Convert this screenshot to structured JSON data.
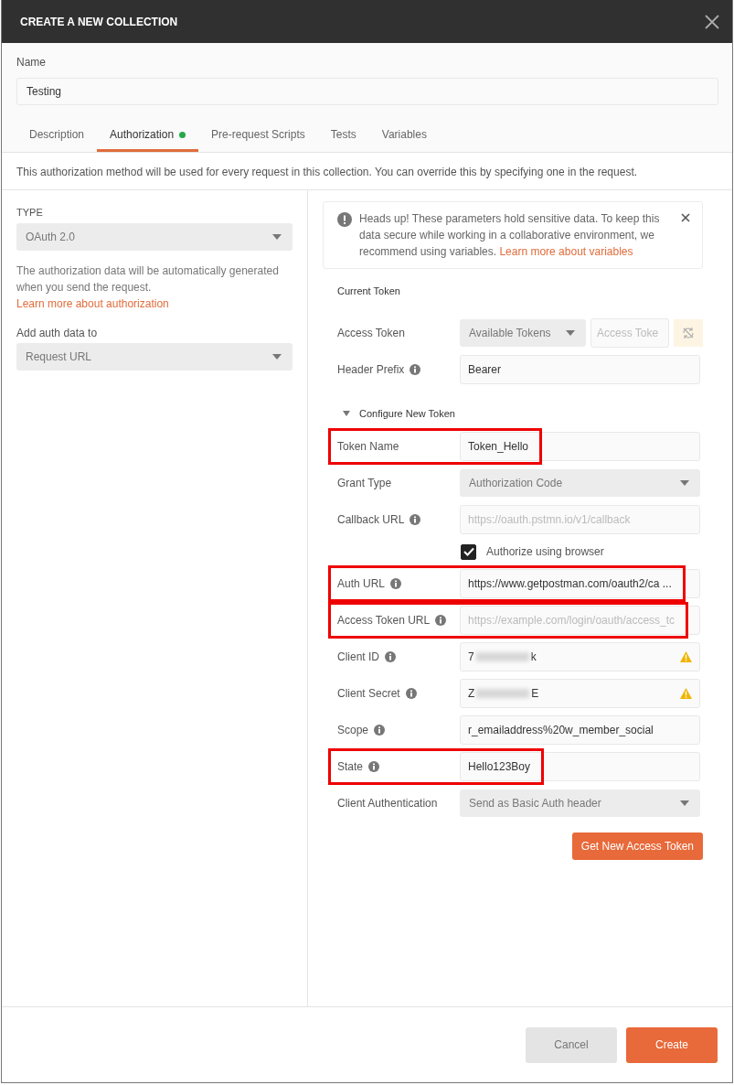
{
  "window": {
    "title": "CREATE A NEW COLLECTION"
  },
  "name_field": {
    "label": "Name",
    "value": "Testing"
  },
  "tabs": [
    {
      "label": "Description",
      "selected": false,
      "dot": false
    },
    {
      "label": "Authorization",
      "selected": true,
      "dot": true
    },
    {
      "label": "Pre-request Scripts",
      "selected": false,
      "dot": false
    },
    {
      "label": "Tests",
      "selected": false,
      "dot": false
    },
    {
      "label": "Variables",
      "selected": false,
      "dot": false
    }
  ],
  "description": "This authorization method will be used for every request in this collection. You can override this by specifying one in the request.",
  "left": {
    "type_label": "TYPE",
    "type_value": "OAuth 2.0",
    "help": "The authorization data will be automatically generated when you send the request.",
    "help_link": "Learn more about authorization",
    "add_label": "Add auth data to",
    "add_value": "Request URL"
  },
  "alert": {
    "text": "Heads up! These parameters hold sensitive data. To keep this data secure while working in a collaborative environment, we recommend using variables.",
    "link": "Learn more about variables"
  },
  "current_token": {
    "title": "Current Token",
    "rows": [
      {
        "kind": "token",
        "label": "Access Token",
        "info": false,
        "select": "Available Tokens",
        "placeholder": "Access Toke"
      },
      {
        "kind": "text",
        "label": "Header Prefix",
        "info": true,
        "value": "Bearer"
      }
    ]
  },
  "configure": {
    "title": "Configure New Token",
    "expanded": true,
    "rows": [
      {
        "kind": "text",
        "label": "Token Name",
        "info": false,
        "value": "Token_Hello",
        "highlighted": true
      },
      {
        "kind": "select",
        "label": "Grant Type",
        "info": false,
        "value": "Authorization Code"
      },
      {
        "kind": "placeholder",
        "label": "Callback URL",
        "info": true,
        "placeholder": "https://oauth.pstmn.io/v1/callback"
      },
      {
        "kind": "checkbox",
        "label": "Authorize using browser",
        "checked": true
      },
      {
        "kind": "text",
        "label": "Auth URL",
        "info": true,
        "value": "https://www.getpostman.com/oauth2/ca ...",
        "highlighted": true
      },
      {
        "kind": "placeholder",
        "label": "Access Token URL",
        "info": true,
        "placeholder": "https://example.com/login/oauth/access_tc",
        "highlighted": true
      },
      {
        "kind": "redacted",
        "label": "Client ID",
        "info": true,
        "value_start": "7",
        "value_end": "k",
        "warning": true
      },
      {
        "kind": "redacted",
        "label": "Client Secret",
        "info": true,
        "value_start": "Z",
        "value_end": "E",
        "warning": true
      },
      {
        "kind": "text",
        "label": "Scope",
        "info": true,
        "value": "r_emailaddress%20w_member_social"
      },
      {
        "kind": "text",
        "label": "State",
        "info": true,
        "value": "Hello123Boy",
        "highlighted": true
      },
      {
        "kind": "select",
        "label": "Client Authentication",
        "info": false,
        "value": "Send as Basic Auth header"
      }
    ],
    "button": "Get New Access Token"
  },
  "buttons": [
    {
      "label": "Cancel",
      "kind": "secondary"
    },
    {
      "label": "Create",
      "kind": "primary"
    }
  ]
}
